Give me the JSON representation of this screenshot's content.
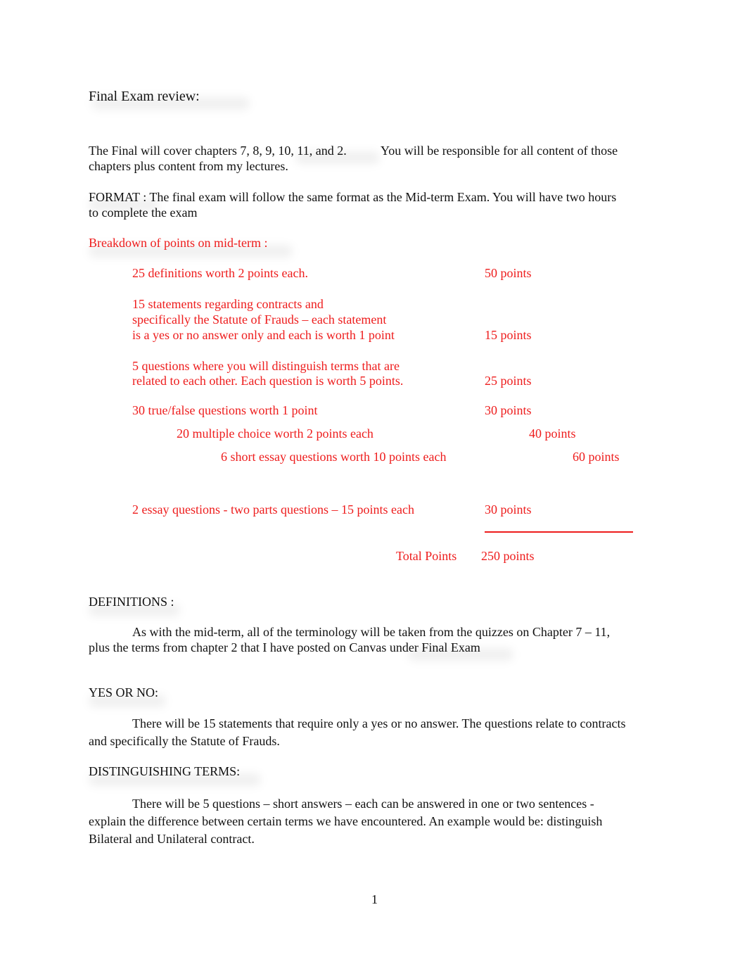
{
  "document": {
    "title": "Final Exam review:",
    "intro": {
      "line1a": "The Final will cover chapters 7, 8, 9, 10, 11, and 2.",
      "line1b": "You will be responsible for all content of those",
      "line2": "chapters plus content from my lectures."
    },
    "format": {
      "line1": "FORMAT :  The final exam will follow the same format as the Mid-term Exam.  You will have two hours",
      "line2": "to complete the exam"
    },
    "breakdown": {
      "heading": "Breakdown of points on mid-term   :",
      "items": [
        {
          "lines": [
            "25 definitions worth 2 points each."
          ],
          "points": "50 points"
        },
        {
          "lines": [
            "15 statements regarding contracts and",
            "specifically the Statute of Frauds – each statement",
            "is a yes or no answer only and each is worth 1 point"
          ],
          "points": "15 points"
        },
        {
          "lines": [
            "5 questions where you will distinguish terms that are",
            "related to each other.  Each question is worth 5 points."
          ],
          "points": "25 points"
        },
        {
          "lines": [
            "30 true/false questions worth 1 point"
          ],
          "points": "30 points"
        },
        {
          "lines": [
            "20 multiple choice worth 2 points each"
          ],
          "points": "40 points"
        },
        {
          "lines": [
            "6 short essay questions worth 10 points each"
          ],
          "points": "60 points"
        },
        {
          "lines": [
            "2 essay questions - two parts questions – 15 points each"
          ],
          "points": "30 points"
        }
      ],
      "total_label": "Total Points",
      "total_value": "250 points"
    },
    "definitions": {
      "heading": "DEFINITIONS :",
      "line1": "As with the mid-term, all of the terminology will be taken from the quizzes on Chapter 7 – 11,",
      "line2": "plus the terms from chapter 2 that I have posted on Canvas under Final Exam"
    },
    "yes_no": {
      "heading": "YES OR NO:",
      "line1": "There will be 15 statements that require only a yes or no answer.  The questions relate to contracts",
      "line2": "and specifically the Statute of Frauds."
    },
    "distinguishing": {
      "heading": "DISTINGUISHING TERMS:",
      "line1": "There will be 5 questions – short answers – each can be answered in one or two sentences -",
      "line2": "explain the difference between certain terms we have encountered. An example would be: distinguish",
      "line3": "Bilateral and Unilateral contract."
    },
    "page_number": "1"
  },
  "colors": {
    "text": "#111111",
    "accent_red": "#ee1c1c",
    "background": "#ffffff"
  }
}
